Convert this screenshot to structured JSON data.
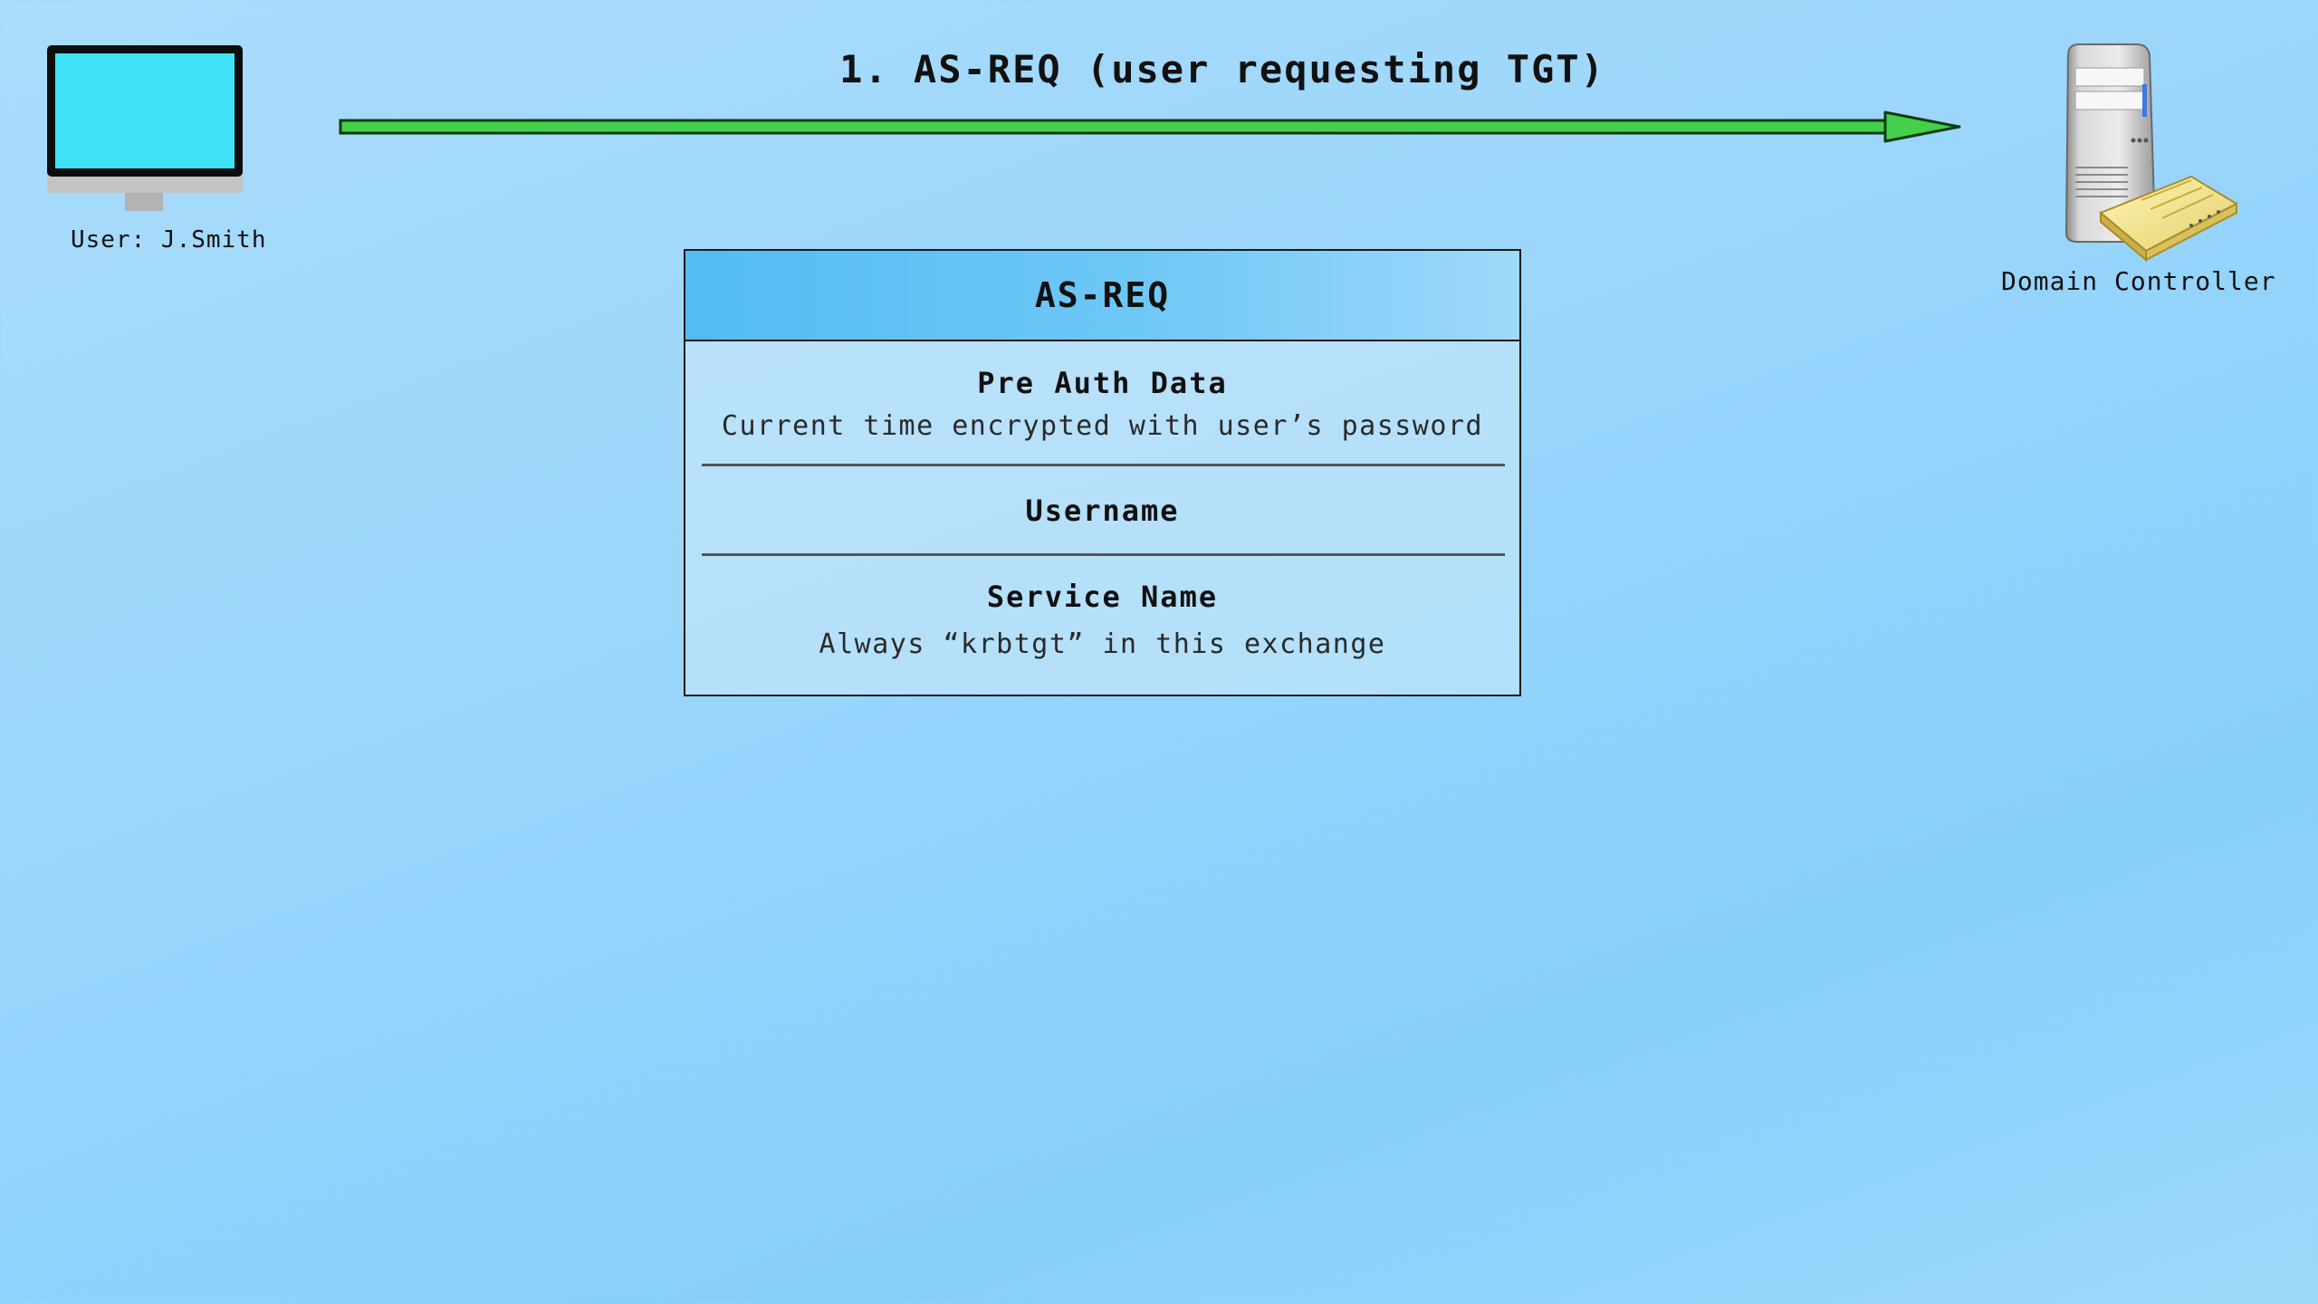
{
  "step_title": "1. AS-REQ (user requesting TGT)",
  "client": {
    "label": "User: J.Smith",
    "icon": "computer-icon"
  },
  "server": {
    "label": "Domain Controller",
    "icon": "domain-controller-icon"
  },
  "arrow": {
    "direction": "client-to-server",
    "color": "#44d04a"
  },
  "packet": {
    "title": "AS-REQ",
    "fields": [
      {
        "name": "Pre Auth Data",
        "description": "Current time encrypted with user’s password"
      },
      {
        "name": "Username"
      },
      {
        "name": "Service Name",
        "description": "Always “krbtgt” in this exchange"
      }
    ]
  }
}
